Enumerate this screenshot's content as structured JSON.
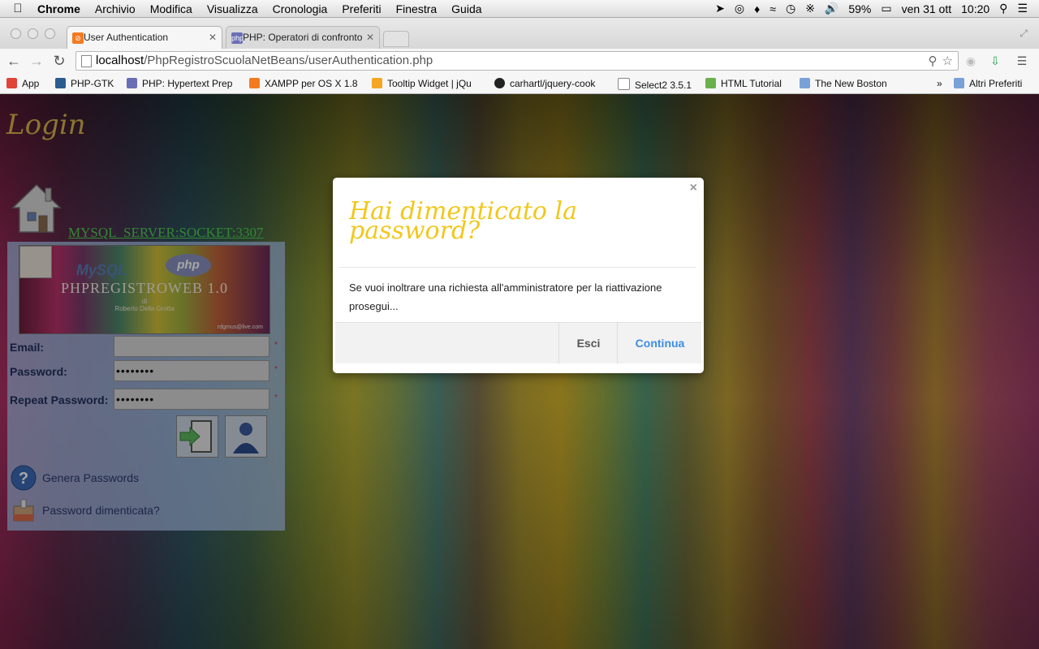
{
  "menubar": {
    "app": "Chrome",
    "items": [
      "Archivio",
      "Modifica",
      "Visualizza",
      "Cronologia",
      "Preferiti",
      "Finestra",
      "Guida"
    ],
    "battery": "59%",
    "date": "ven 31 ott",
    "time": "10:20"
  },
  "tabs": [
    {
      "title": "User Authentication",
      "favicon": "xampp-icon"
    },
    {
      "title": "PHP: Operatori di confronto",
      "favicon": "php-icon"
    }
  ],
  "address": {
    "host": "localhost",
    "path": "/PhpRegistroScuolaNetBeans/userAuthentication.php"
  },
  "bookmarks": [
    {
      "label": "App",
      "icon": "apps-grid-icon",
      "color": "#e0453a"
    },
    {
      "label": "PHP-GTK",
      "icon": "php-gtk-icon",
      "color": "#2b5d8f"
    },
    {
      "label": "PHP: Hypertext Prep",
      "icon": "php-icon",
      "color": "#6a6fb5"
    },
    {
      "label": "XAMPP per OS X 1.8",
      "icon": "xampp-icon",
      "color": "#f47a20"
    },
    {
      "label": "Tooltip Widget | jQu",
      "icon": "jquery-ui-icon",
      "color": "#f5a623"
    },
    {
      "label": "carhartl/jquery-cook",
      "icon": "github-icon",
      "color": "#222222"
    },
    {
      "label": "Select2 3.5.1",
      "icon": "page-icon",
      "color": "#ffffff"
    },
    {
      "label": "HTML Tutorial",
      "icon": "w3schools-icon",
      "color": "#6ab04c"
    },
    {
      "label": "The New Boston",
      "icon": "folder-icon",
      "color": "#7aa0d8"
    },
    {
      "label": "Altri Preferiti",
      "icon": "folder-icon",
      "color": "#7aa0d8"
    }
  ],
  "page": {
    "login_title": "Login",
    "server_link": "MYSQL_SERVER:SOCKET:3307",
    "banner": {
      "title": "PHPREGISTROWEB 1.0",
      "line1": "di",
      "line2": "Roberto Della Grotta",
      "email": "rdgmus@live.com",
      "mysql": "MySQL",
      "php": "php"
    },
    "fields": [
      {
        "label": "Email:",
        "value": ""
      },
      {
        "label": "Password:",
        "value": "••••••••"
      },
      {
        "label": "Repeat Password:",
        "value": "••••••••"
      }
    ],
    "required_mark": "*",
    "links": {
      "generate": "Genera Passwords",
      "forgot": "Password dimenticata?"
    }
  },
  "modal": {
    "close": "×",
    "title": "Hai dimenticato la password?",
    "body": "Se vuoi inoltrare una richiesta all'amministratore per la riattivazione prosegui...",
    "cancel_label": "Esci",
    "confirm_label": "Continua"
  }
}
